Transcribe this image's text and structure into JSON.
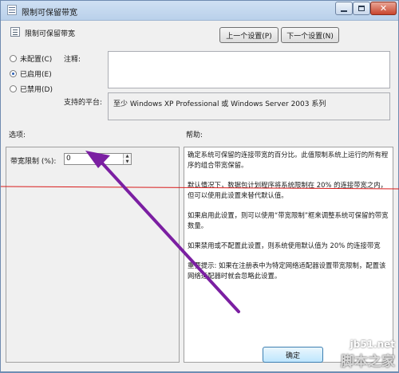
{
  "window": {
    "title": "限制可保留带宽"
  },
  "header": {
    "policy_title": "限制可保留带宽",
    "prev_button": "上一个设置(P)",
    "next_button": "下一个设置(N)"
  },
  "state": {
    "options": [
      {
        "label": "未配置(C)",
        "checked": false
      },
      {
        "label": "已启用(E)",
        "checked": true
      },
      {
        "label": "已禁用(D)",
        "checked": false
      }
    ],
    "comment_label": "注释:",
    "comment_value": "",
    "platform_label": "支持的平台:",
    "platform_value": "至少 Windows XP Professional 或 Windows Server 2003 系列"
  },
  "options_section": {
    "heading": "选项:",
    "bandwidth_label": "带宽限制 (%):",
    "bandwidth_value": "0"
  },
  "help_section": {
    "heading": "帮助:",
    "paragraphs": [
      "确定系统可保留的连接带宽的百分比。此值限制系统上运行的所有程序的组合带宽保留。",
      "默认情况下，数据包计划程序将系统限制在 20% 的连接带宽之内，但可以使用此设置来替代默认值。",
      "如果启用此设置，则可以使用“带宽限制”框来调整系统可保留的带宽数量。",
      "如果禁用或不配置此设置，则系统使用默认值为 20% 的连接带宽",
      "重要提示: 如果在注册表中为特定网络适配器设置带宽限制，配置该网络适配器时就会忽略此设置。"
    ]
  },
  "footer": {
    "ok_button": "确定"
  },
  "watermark": {
    "url": "jb51.net",
    "name": "脚本之家"
  },
  "annotations": {
    "red_line_color": "#d81b1b",
    "arrow_color": "#7b1fa2"
  }
}
